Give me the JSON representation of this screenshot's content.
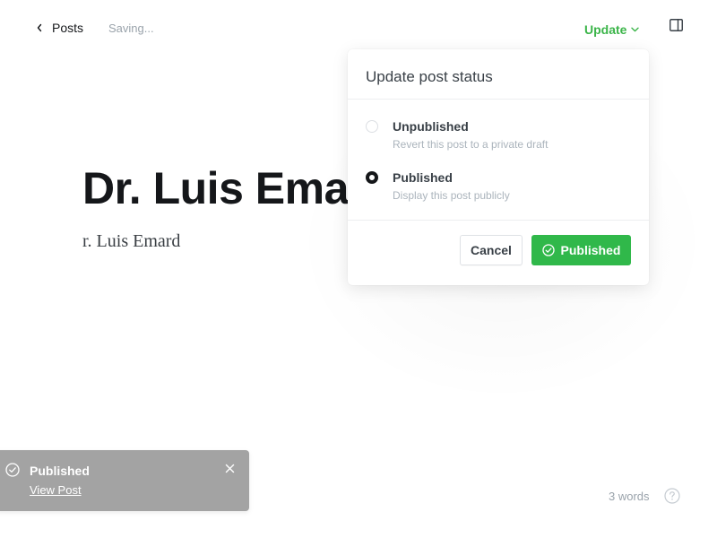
{
  "header": {
    "back_label": "Posts",
    "status_text": "Saving...",
    "update_label": "Update"
  },
  "editor": {
    "title": "Dr. Luis Emard",
    "body": "r. Luis Emard"
  },
  "popover": {
    "title": "Update post status",
    "options": [
      {
        "label": "Unpublished",
        "description": "Revert this post to a private draft",
        "selected": false
      },
      {
        "label": "Published",
        "description": "Display this post publicly",
        "selected": true
      }
    ],
    "cancel_label": "Cancel",
    "confirm_label": "Published"
  },
  "toast": {
    "title": "Published",
    "link_text": "View Post"
  },
  "footer": {
    "word_count": "3 words"
  },
  "colors": {
    "accent_green": "#30b84a",
    "update_green": "#3cb54a",
    "toast_bg": "#a3a3a3"
  },
  "icons": {
    "back": "chevron-left-icon",
    "update": "chevron-down-icon",
    "panel": "sidebar-toggle-icon",
    "confirm": "check-circle-icon",
    "toast": "check-circle-icon",
    "toast_close": "close-icon",
    "help": "question-circle-icon"
  }
}
